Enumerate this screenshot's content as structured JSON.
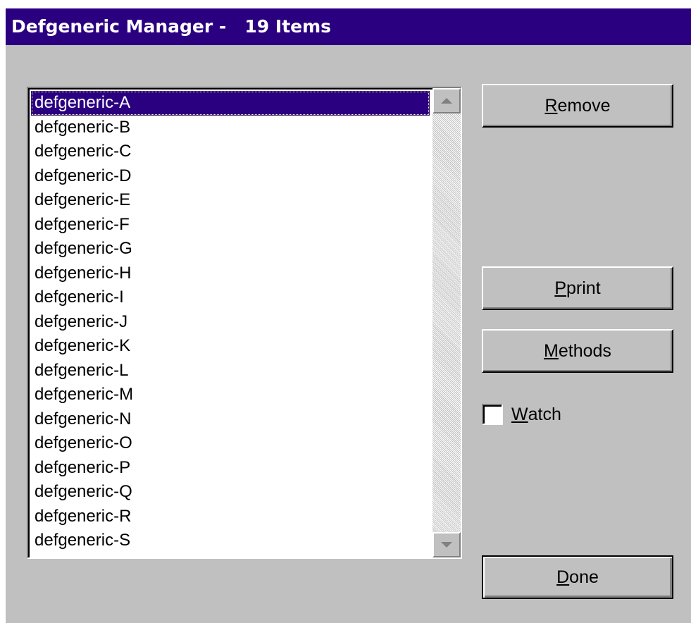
{
  "window": {
    "title": "Defgeneric Manager -   19 Items"
  },
  "list": {
    "selected_index": 0,
    "items": [
      "defgeneric-A",
      "defgeneric-B",
      "defgeneric-C",
      "defgeneric-D",
      "defgeneric-E",
      "defgeneric-F",
      "defgeneric-G",
      "defgeneric-H",
      "defgeneric-I",
      "defgeneric-J",
      "defgeneric-K",
      "defgeneric-L",
      "defgeneric-M",
      "defgeneric-N",
      "defgeneric-O",
      "defgeneric-P",
      "defgeneric-Q",
      "defgeneric-R",
      "defgeneric-S"
    ]
  },
  "buttons": {
    "remove": {
      "mnemonic": "R",
      "rest": "emove"
    },
    "pprint": {
      "mnemonic": "P",
      "rest": "print"
    },
    "methods": {
      "mnemonic": "M",
      "rest": "ethods"
    },
    "done": {
      "mnemonic": "D",
      "rest": "one"
    }
  },
  "watch": {
    "mnemonic": "W",
    "rest": "atch",
    "checked": false
  },
  "colors": {
    "titlebar": "#2a0080",
    "face": "#c0c0c0",
    "selection": "#2a0080"
  },
  "icons": {
    "scroll_up": "scroll-up-arrow-icon",
    "scroll_down": "scroll-down-arrow-icon"
  }
}
